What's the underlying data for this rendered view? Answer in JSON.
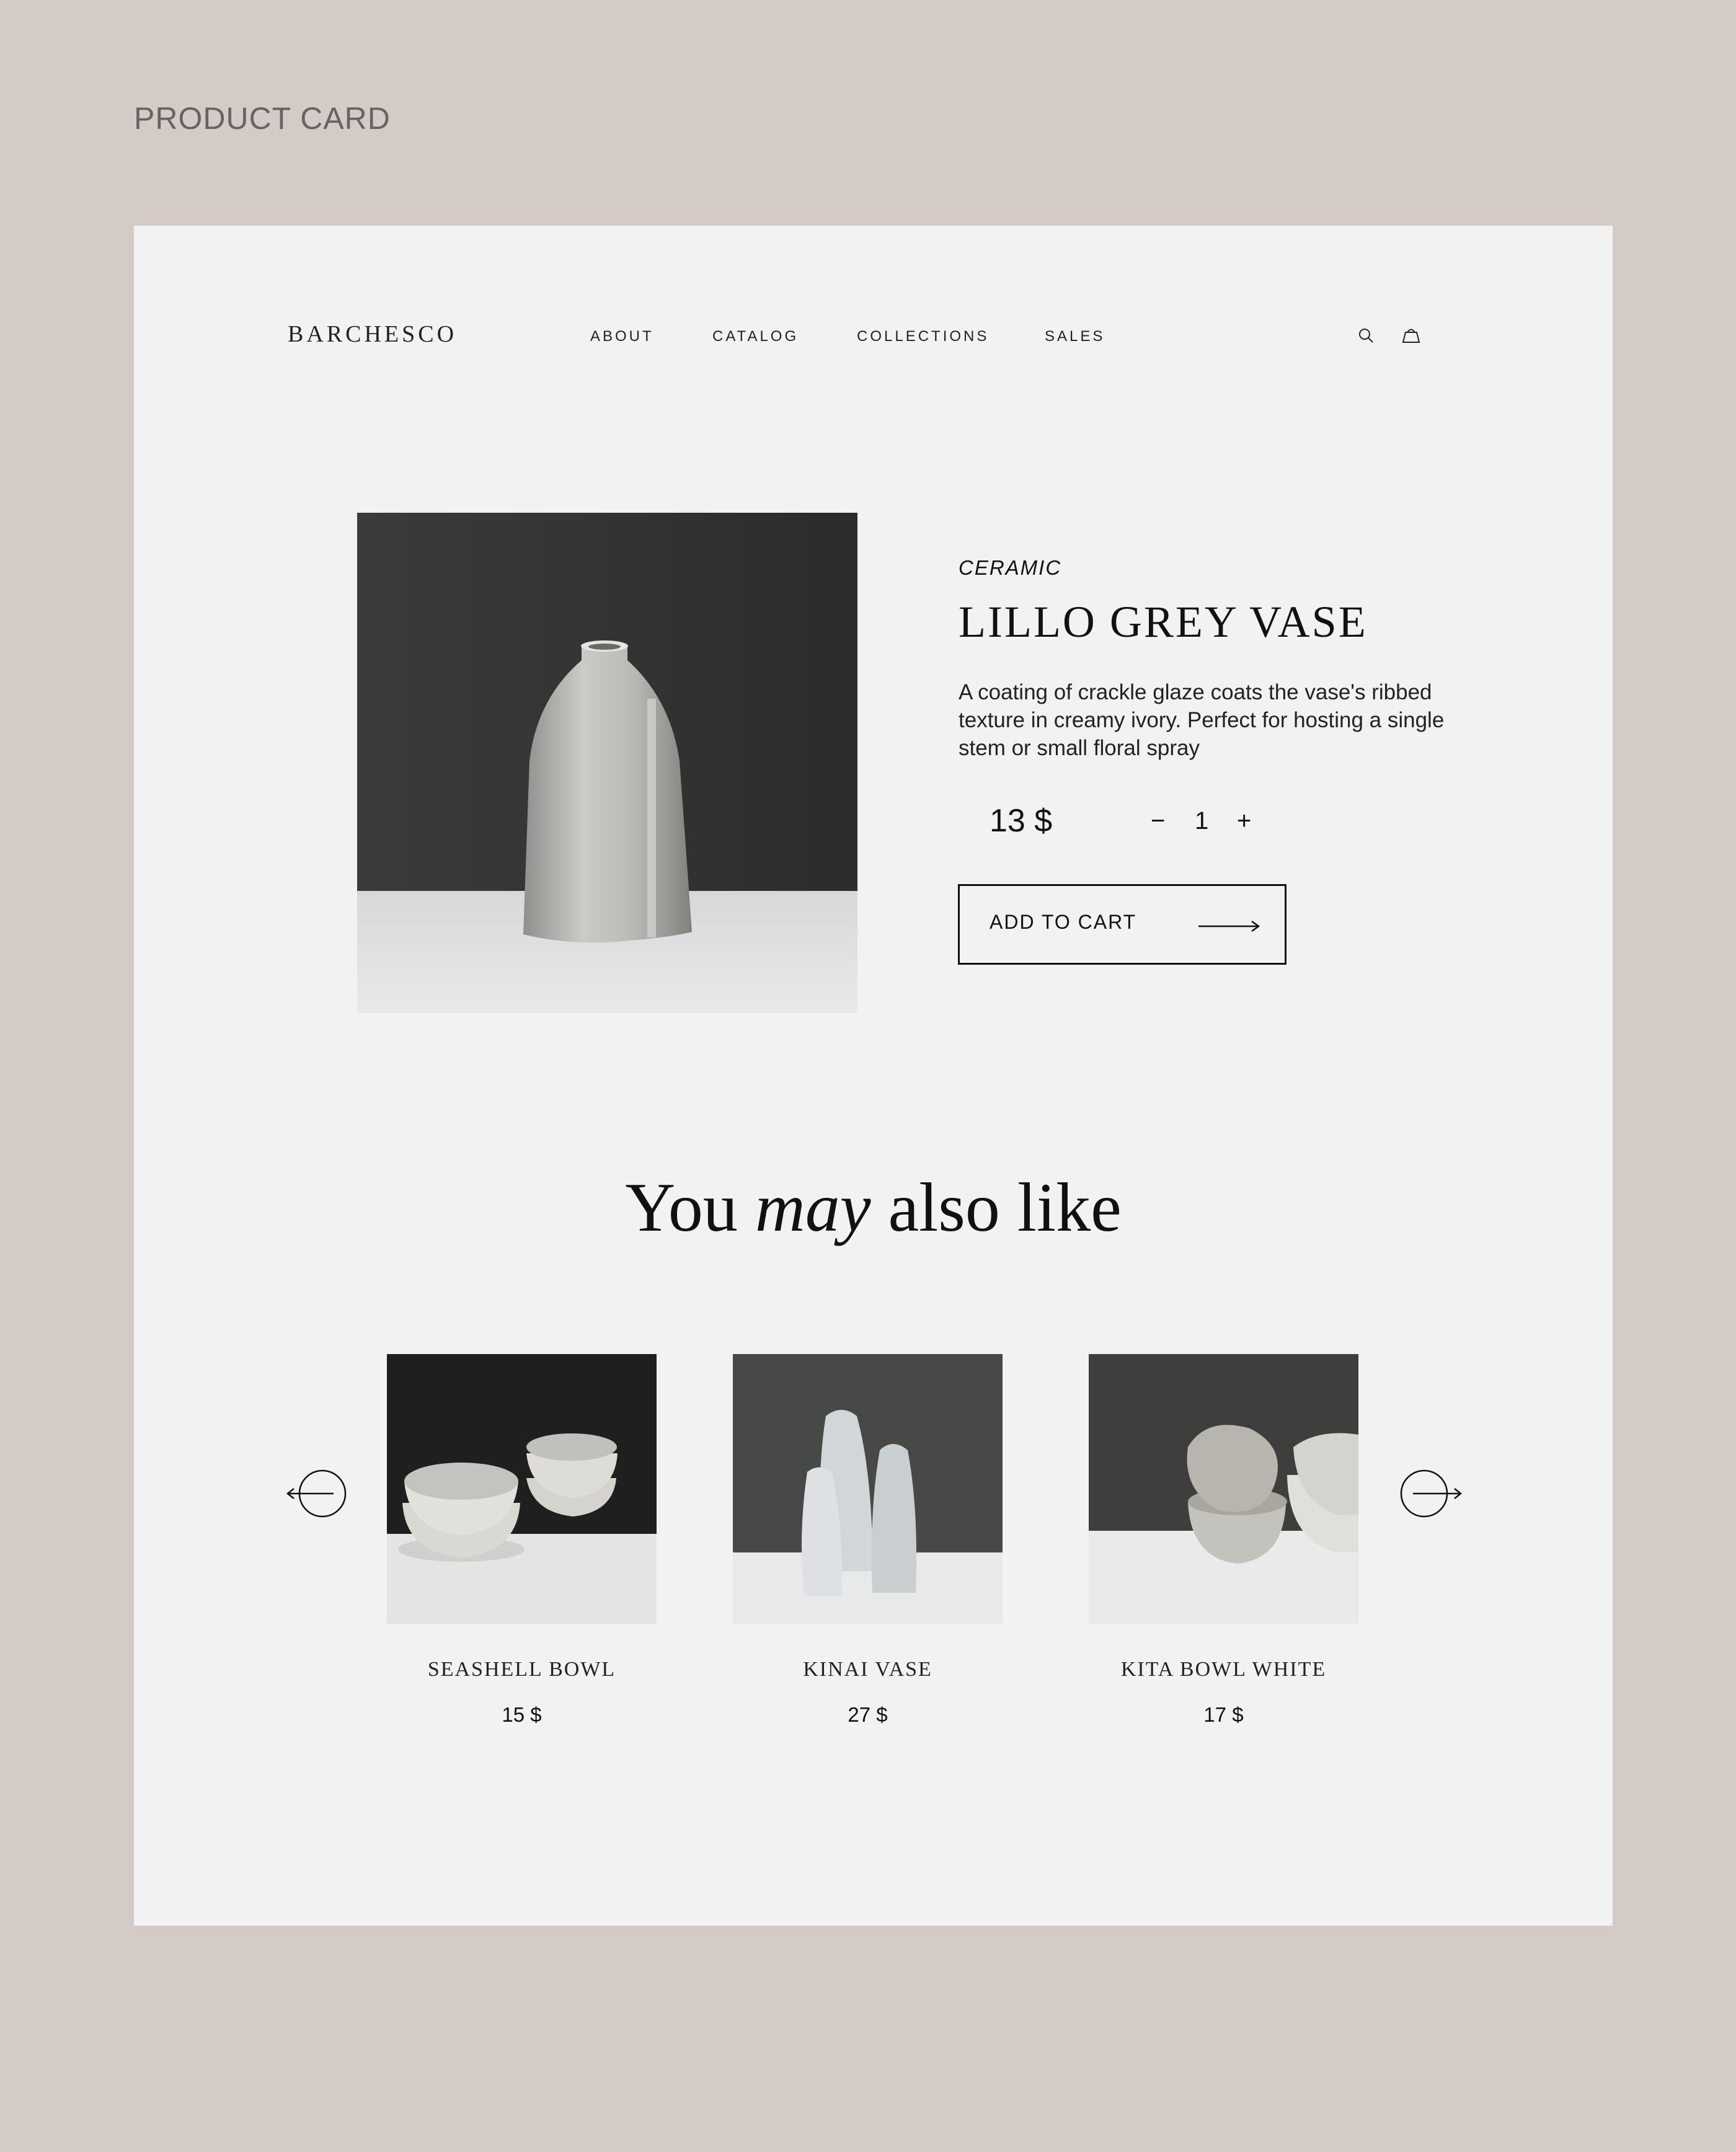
{
  "page_label": "PRODUCT CARD",
  "header": {
    "logo": "BARCHESCO",
    "nav": [
      "ABOUT",
      "CATALOG",
      "COLLECTIONS",
      "SALES"
    ],
    "icons": [
      "search-icon",
      "cart-icon"
    ]
  },
  "product": {
    "category": "CERAMIC",
    "title": "LILLO GREY VASE",
    "description": "A coating of crackle glaze coats the vase's ribbed texture in creamy ivory. Perfect for hosting a single stem or small floral spray",
    "price": "13 $",
    "quantity": "1",
    "qty_minus": "−",
    "qty_plus": "+",
    "add_to_cart": "ADD TO CART"
  },
  "related": {
    "heading_pre": "You ",
    "heading_em": "may",
    "heading_post": " also like",
    "items": [
      {
        "name": "SEASHELL BOWL",
        "price": "15 $"
      },
      {
        "name": "KINAI VASE",
        "price": "27 $"
      },
      {
        "name": "KITA BOWL WHITE",
        "price": "17 $"
      }
    ]
  },
  "colors": {
    "page_bg": "#d5cbc6",
    "card_bg": "#f2f2f2",
    "text": "#111111"
  }
}
